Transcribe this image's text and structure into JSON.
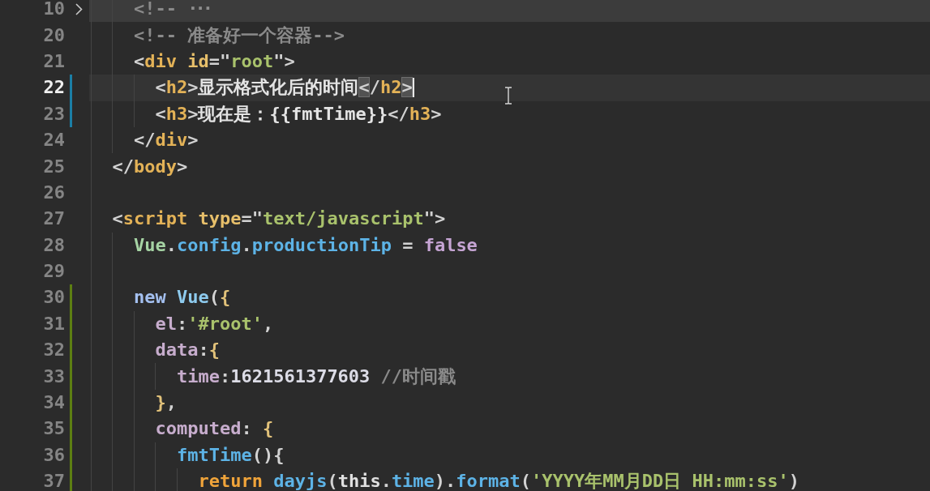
{
  "editor": {
    "lines": [
      {
        "children": [
          {
            "number": "10",
            "current": false,
            "folded": true,
            "tokens": [
              {
                "kind": "comment",
                "text": "<!--"
              }
            ],
            "folded_text": "···"
          },
          {
            "number": "20",
            "current": false,
            "folded": false,
            "tokens": [
              {
                "kind": "comment",
                "text": "<!-- 准备好一个容器-->"
              }
            ]
          },
          {
            "number": "21",
            "current": false,
            "folded": false,
            "tokens": [
              {
                "kind": "punct",
                "text": "<"
              },
              {
                "kind": "tag",
                "text": "div"
              },
              {
                "kind": "attr",
                "text": " id"
              },
              {
                "kind": "punct",
                "text": "=\""
              },
              {
                "kind": "string",
                "text": "root"
              },
              {
                "kind": "punct",
                "text": "\">"
              }
            ],
            "children": [
              {
                "number": "22",
                "current": true,
                "folded": false,
                "color": "#1b7fa6",
                "tokens": [
                  {
                    "kind": "punct",
                    "text": "<"
                  },
                  {
                    "kind": "tag",
                    "text": "h2"
                  },
                  {
                    "kind": "punct",
                    "text": ">"
                  },
                  {
                    "kind": "text",
                    "text": "显示格式化后的时间"
                  },
                  {
                    "kind": "punct",
                    "text": "<",
                    "match": true
                  },
                  {
                    "kind": "punct",
                    "text": "/"
                  },
                  {
                    "kind": "tag",
                    "text": "h2"
                  },
                  {
                    "kind": "punct",
                    "text": ">",
                    "match": true
                  }
                ]
              },
              {
                "number": "23",
                "current": false,
                "folded": false,
                "color": "#1b7fa6",
                "tokens": [
                  {
                    "kind": "punct",
                    "text": "<"
                  },
                  {
                    "kind": "tag",
                    "text": "h3"
                  },
                  {
                    "kind": "punct",
                    "text": ">"
                  },
                  {
                    "kind": "text",
                    "text": "现在是：{{fmtTime}}"
                  },
                  {
                    "kind": "punct",
                    "text": "</"
                  },
                  {
                    "kind": "tag",
                    "text": "h3"
                  },
                  {
                    "kind": "punct",
                    "text": ">"
                  }
                ]
              }
            ]
          },
          {
            "number": "24",
            "current": false,
            "folded": false,
            "tokens": [
              {
                "kind": "punct",
                "text": "</"
              },
              {
                "kind": "tag",
                "text": "div"
              },
              {
                "kind": "punct",
                "text": ">"
              }
            ]
          }
        ]
      },
      {
        "number": "25",
        "current": false,
        "folded": false,
        "tokens": [
          {
            "kind": "punct",
            "text": "</"
          },
          {
            "kind": "tag",
            "text": "body"
          },
          {
            "kind": "punct",
            "text": ">"
          }
        ]
      },
      {
        "number": "26",
        "current": false,
        "folded": false
      },
      {
        "number": "27",
        "current": false,
        "folded": false,
        "tokens": [
          {
            "kind": "punct",
            "text": "<"
          },
          {
            "kind": "tag",
            "text": "script"
          },
          {
            "kind": "attr",
            "text": " type"
          },
          {
            "kind": "punct",
            "text": "=\""
          },
          {
            "kind": "string",
            "text": "text/javascript"
          },
          {
            "kind": "punct",
            "text": "\">"
          }
        ],
        "children": [
          {
            "number": "28",
            "current": false,
            "folded": false,
            "tokens": [
              {
                "kind": "variable",
                "text": "Vue"
              },
              {
                "kind": "punct",
                "text": "."
              },
              {
                "kind": "property",
                "text": "config"
              },
              {
                "kind": "punct",
                "text": "."
              },
              {
                "kind": "property",
                "text": "productionTip"
              },
              {
                "kind": "punct",
                "text": " = "
              },
              {
                "kind": "boolean",
                "text": "false"
              }
            ]
          },
          {
            "number": "29",
            "current": false,
            "folded": false
          },
          {
            "number": "30",
            "current": false,
            "folded": false,
            "color": "#5d7f12",
            "tokens": [
              {
                "kind": "keyword",
                "text": "new"
              },
              {
                "kind": "class",
                "text": " Vue"
              },
              {
                "kind": "punct",
                "text": "("
              },
              {
                "kind": "bracket",
                "text": "{"
              }
            ],
            "children": [
              {
                "number": "31",
                "current": false,
                "folded": false,
                "color": "#5d7f12",
                "tokens": [
                  {
                    "kind": "key",
                    "text": "el"
                  },
                  {
                    "kind": "punct",
                    "text": ":"
                  },
                  {
                    "kind": "string",
                    "text": "'#root'"
                  },
                  {
                    "kind": "punct",
                    "text": ","
                  }
                ]
              },
              {
                "number": "32",
                "current": false,
                "folded": false,
                "color": "#5d7f12",
                "tokens": [
                  {
                    "kind": "key",
                    "text": "data"
                  },
                  {
                    "kind": "punct",
                    "text": ":"
                  },
                  {
                    "kind": "bracket",
                    "text": "{"
                  }
                ],
                "children": [
                  {
                    "number": "33",
                    "current": false,
                    "folded": false,
                    "color": "#5d7f12",
                    "tokens": [
                      {
                        "kind": "key",
                        "text": "time"
                      },
                      {
                        "kind": "punct",
                        "text": ":"
                      },
                      {
                        "kind": "number",
                        "text": "1621561377603"
                      },
                      {
                        "kind": "comment",
                        "text": " //时间戳"
                      }
                    ]
                  }
                ]
              },
              {
                "number": "34",
                "current": false,
                "folded": false,
                "color": "#5d7f12",
                "tokens": [
                  {
                    "kind": "bracket",
                    "text": "}"
                  },
                  {
                    "kind": "punct",
                    "text": ","
                  }
                ]
              },
              {
                "number": "35",
                "current": false,
                "folded": false,
                "color": "#5d7f12",
                "tokens": [
                  {
                    "kind": "key",
                    "text": "computed"
                  },
                  {
                    "kind": "punct",
                    "text": ": "
                  },
                  {
                    "kind": "bracket",
                    "text": "{"
                  }
                ],
                "children": [
                  {
                    "number": "36",
                    "current": false,
                    "folded": false,
                    "color": "#5d7f12",
                    "tokens": [
                      {
                        "kind": "property",
                        "text": "fmtTime"
                      },
                      {
                        "kind": "punct",
                        "text": "(){"
                      }
                    ],
                    "children": [
                      {
                        "number": "37",
                        "current": false,
                        "folded": false,
                        "color": "#5d7f12",
                        "tokens": [
                          {
                            "kind": "control",
                            "text": "return"
                          },
                          {
                            "kind": "property",
                            "text": " dayjs"
                          },
                          {
                            "kind": "punct",
                            "text": "("
                          },
                          {
                            "kind": "this",
                            "text": "this"
                          },
                          {
                            "kind": "punct",
                            "text": "."
                          },
                          {
                            "kind": "property",
                            "text": "time"
                          },
                          {
                            "kind": "punct",
                            "text": ")."
                          },
                          {
                            "kind": "property",
                            "text": "format"
                          },
                          {
                            "kind": "punct",
                            "text": "("
                          },
                          {
                            "kind": "string",
                            "text": "'YYYY年MM月DD日 HH:mm:ss'"
                          },
                          {
                            "kind": "punct",
                            "text": ")"
                          }
                        ]
                      }
                    ]
                  }
                ]
              }
            ]
          }
        ]
      }
    ]
  }
}
